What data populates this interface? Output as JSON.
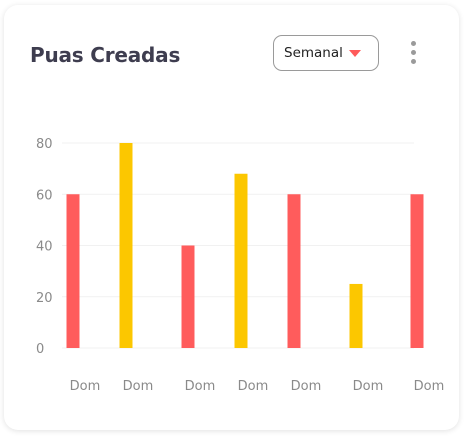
{
  "header": {
    "title": "Puas Creadas",
    "period": "Semanal",
    "menu_icon": "kebab-menu-icon",
    "dropdown_icon": "caret-down-icon"
  },
  "colors": {
    "red": "#ff5c5c",
    "yellow": "#fcc700",
    "title": "#3e3d4f",
    "axis_text": "#8a8a8a"
  },
  "chart_data": {
    "type": "bar",
    "categories": [
      "Dom",
      "Dom",
      "Dom",
      "Dom",
      "Dom",
      "Dom",
      "Dom"
    ],
    "series": [
      {
        "values": [
          60,
          80,
          40,
          68,
          60,
          25,
          60
        ]
      }
    ],
    "bar_colors": [
      "#ff5c5c",
      "#fcc700",
      "#ff5c5c",
      "#fcc700",
      "#ff5c5c",
      "#fcc700",
      "#ff5c5c"
    ],
    "yticks": [
      0,
      20,
      40,
      60,
      80
    ],
    "ylim": [
      0,
      80
    ],
    "grid": true,
    "legend": "none"
  }
}
